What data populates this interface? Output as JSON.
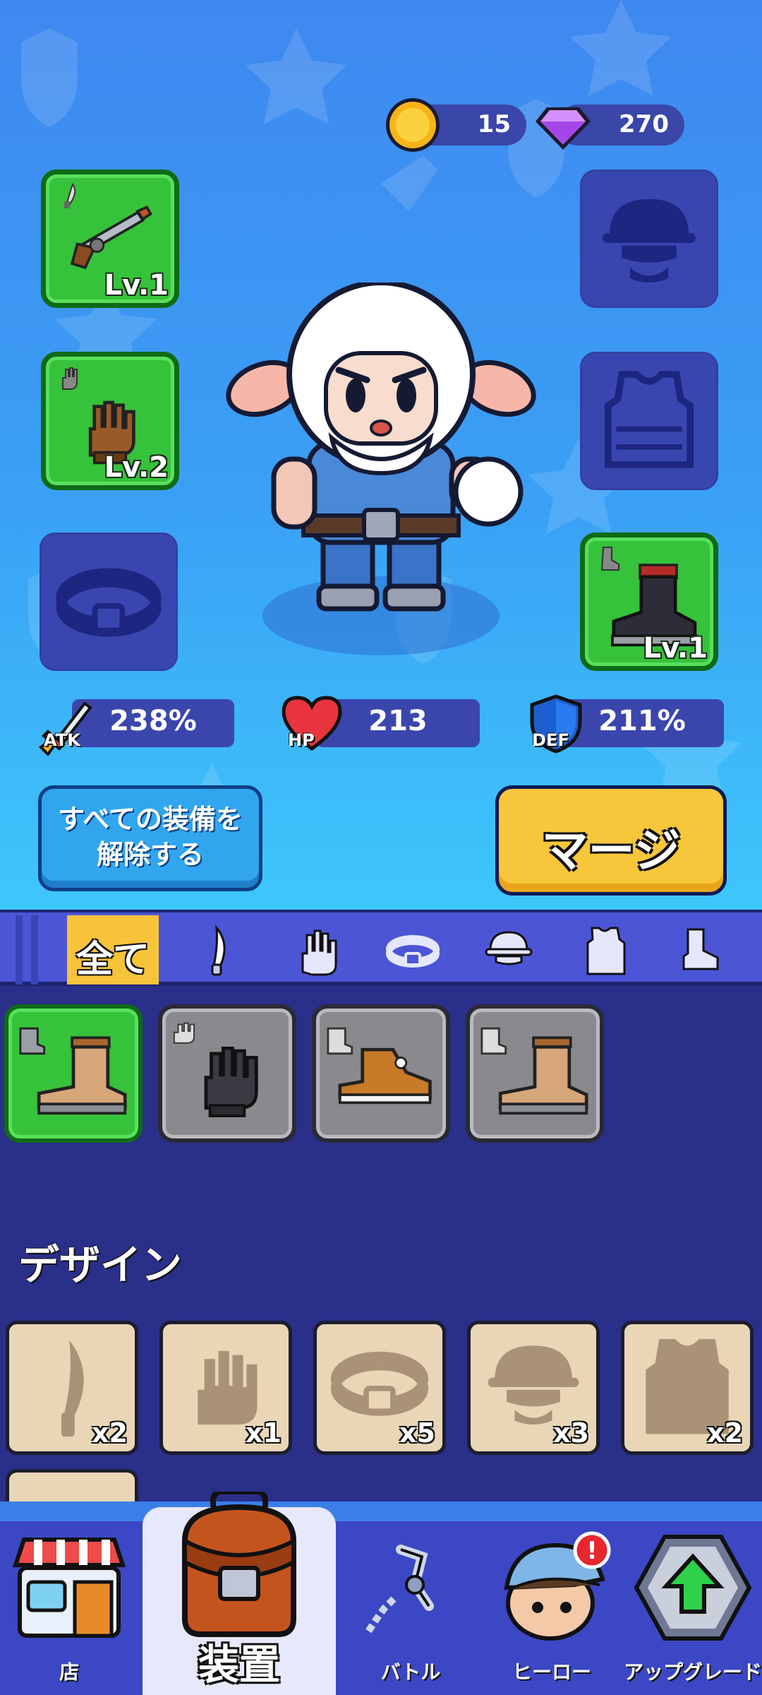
{
  "currency": {
    "coins": "15",
    "gems": "270"
  },
  "equipment": {
    "weapon_level": "Lv.1",
    "gloves_level": "Lv.2",
    "boots_level": "Lv.1"
  },
  "stats": {
    "atk_label": "ATK",
    "atk_value": "238%",
    "hp_label": "HP",
    "hp_value": "213",
    "def_label": "DEF",
    "def_value": "211%"
  },
  "buttons": {
    "unequip_line1": "すべての装備を",
    "unequip_line2": "解除する",
    "merge": "マージ"
  },
  "filter": {
    "all": "全て",
    "icons": [
      "knife-icon",
      "glove-icon",
      "belt-icon",
      "helmet-icon",
      "vest-icon",
      "boot-icon"
    ]
  },
  "inventory": {
    "items": [
      "boots-green",
      "gloves-grey",
      "sneakers-grey",
      "boots-grey"
    ]
  },
  "design": {
    "title": "デザイン",
    "cards": [
      {
        "icon": "knife-icon",
        "count": "x2"
      },
      {
        "icon": "glove-icon",
        "count": "x1"
      },
      {
        "icon": "belt-icon",
        "count": "x5"
      },
      {
        "icon": "helmet-icon",
        "count": "x3"
      },
      {
        "icon": "vest-icon",
        "count": "x2"
      }
    ]
  },
  "nav": {
    "shop": "店",
    "equipment": "装置",
    "battle": "バトル",
    "hero": "ヒーロー",
    "upgrade": "アップグレード",
    "hero_badge": "!"
  },
  "colors": {
    "equipped_green": "#36c23a",
    "merge_yellow": "#f7c63a",
    "panel_blue": "#3b46ad"
  }
}
